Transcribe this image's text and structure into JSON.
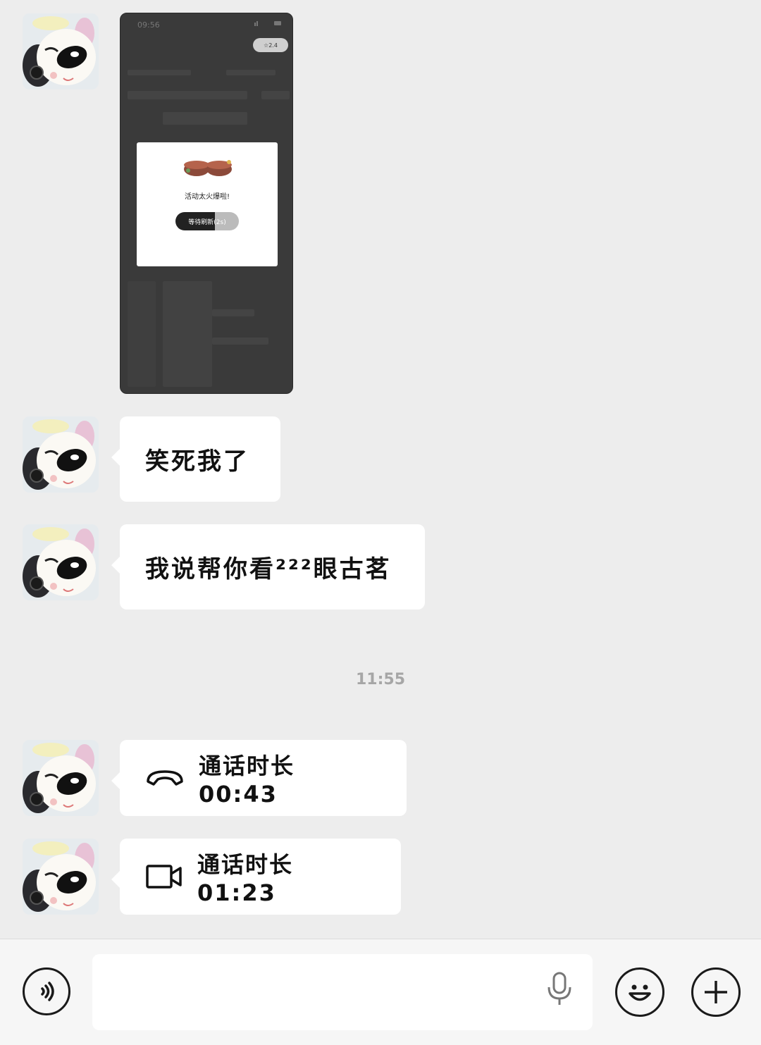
{
  "messages": [
    {
      "type": "image",
      "screenshot": {
        "status_time": "09:56",
        "pill_label": "☆2.4",
        "dialog_text": "活动太火爆啦!",
        "dialog_button": "等待刷新(2s)",
        "button_progress": 0.62
      }
    },
    {
      "type": "text",
      "text": "笑死我了"
    },
    {
      "type": "text",
      "text": "我说帮你看²²²眼古茗"
    },
    {
      "type": "call",
      "icon": "phone-hangup-icon",
      "text": "通话时长 00:43"
    },
    {
      "type": "call",
      "icon": "video-camera-icon",
      "text": "通话时长 01:23"
    }
  ],
  "timestamp": "11:55",
  "input_bar": {
    "voice_icon": "voice-mode-icon",
    "mic_icon": "microphone-icon",
    "emoji_icon": "emoji-icon",
    "plus_icon": "plus-icon",
    "input_value": ""
  },
  "colors": {
    "background": "#ededed",
    "bubble": "#ffffff",
    "timestamp": "#a6a6a6",
    "input_bar": "#f6f6f6"
  }
}
